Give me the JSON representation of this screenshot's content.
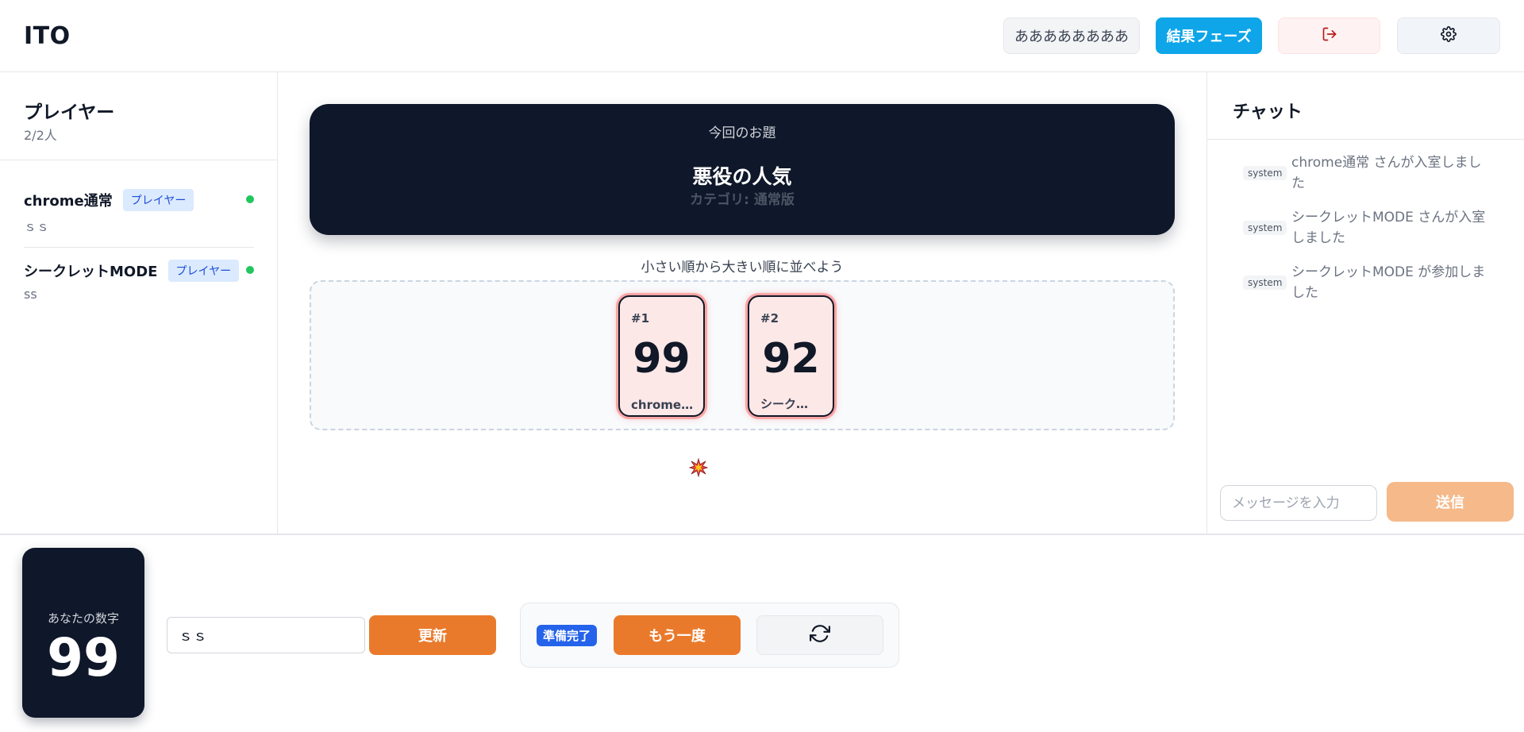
{
  "header": {
    "logo": "ITO",
    "room_button": "ああああああああ",
    "result_phase_button": "結果フェーズ",
    "leave_icon": "logout-icon",
    "settings_icon": "gear-icon"
  },
  "players_panel": {
    "title": "プレイヤー",
    "count": "2/2人",
    "players": [
      {
        "name": "chrome通常",
        "role": "プレイヤー",
        "word": "ｓｓ",
        "online": true
      },
      {
        "name": "シークレットMODE",
        "role": "プレイヤー",
        "word": "ss",
        "online": true
      }
    ]
  },
  "topic": {
    "label": "今回のお題",
    "title": "悪役の人気",
    "category": "カテゴリ: 通常版"
  },
  "board": {
    "instruction": "小さい順から大きい順に並べよう",
    "cards": [
      {
        "rank": "#1",
        "number": "99",
        "owner": "chrome…"
      },
      {
        "rank": "#2",
        "number": "92",
        "owner": "シーク…"
      }
    ],
    "failure_icon": "explosion-icon"
  },
  "chat": {
    "title": "チャット",
    "messages": [
      {
        "sender": "system",
        "text": "chrome通常 さんが入室しました"
      },
      {
        "sender": "system",
        "text": "シークレットMODE さんが入室しました"
      },
      {
        "sender": "system",
        "text": "シークレットMODE が参加しました"
      }
    ],
    "input_placeholder": "メッセージを入力",
    "send_label": "送信"
  },
  "bottom": {
    "my_number_label": "あなたの数字",
    "my_number": "99",
    "word_value": "ｓｓ",
    "update_label": "更新",
    "ready_badge": "準備完了",
    "again_label": "もう一度",
    "refresh_icon": "refresh-icon"
  },
  "colors": {
    "accent_orange": "#ea7a2b",
    "accent_blue": "#0ea5e9",
    "dark_navy": "#0f172a",
    "online_green": "#22c55e"
  }
}
